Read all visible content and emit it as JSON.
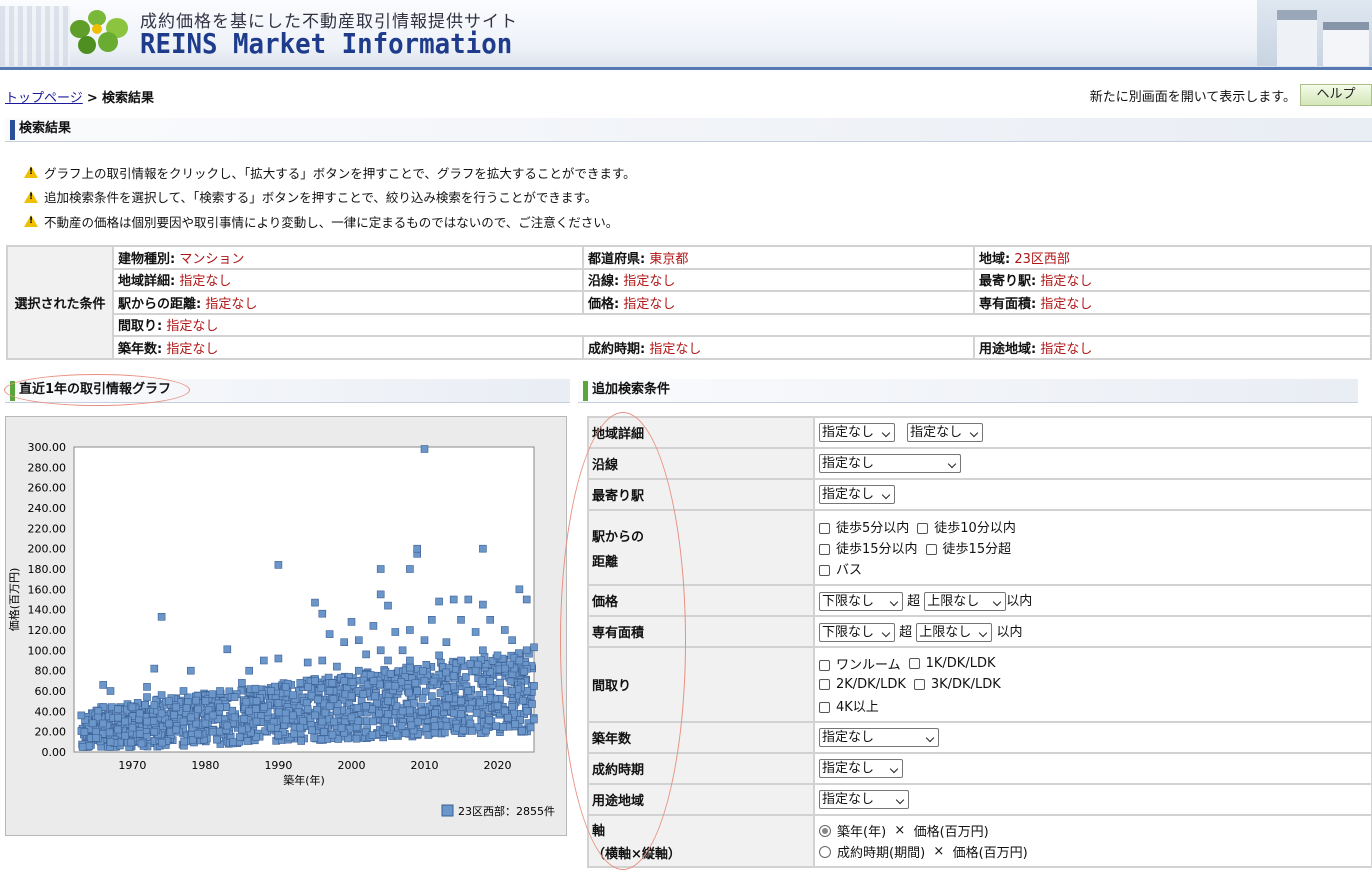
{
  "header": {
    "tagline": "成約価格を基にした不動産取引情報提供サイト",
    "brand": "REINS Market Information"
  },
  "breadcrumb": {
    "top": "トップページ",
    "separator": ">",
    "current": "検索結果"
  },
  "top_right": {
    "note": "新たに別画面を開いて表示します。",
    "help_label": "ヘルプ"
  },
  "section_results": "検索結果",
  "warnings": [
    "グラフ上の取引情報をクリックし、「拡大する」ボタンを押すことで、グラフを拡大することができます。",
    "追加検索条件を選択して、「検索する」ボタンを押すことで、絞り込み検索を行うことができます。",
    "不動産の価格は個別要因や取引事情により変動し、一律に定まるものではないので、ご注意ください。"
  ],
  "conditions": {
    "label": "選択された条件",
    "building_type": {
      "k": "建物種別:",
      "v": "マンション"
    },
    "prefecture": {
      "k": "都道府県:",
      "v": "東京都"
    },
    "area": {
      "k": "地域:",
      "v": "23区西部"
    },
    "area_detail": {
      "k": "地域詳細:",
      "v": "指定なし"
    },
    "line": {
      "k": "沿線:",
      "v": "指定なし"
    },
    "station": {
      "k": "最寄り駅:",
      "v": "指定なし"
    },
    "distance": {
      "k": "駅からの距離:",
      "v": "指定なし"
    },
    "price": {
      "k": "価格:",
      "v": "指定なし"
    },
    "floor_area": {
      "k": "専有面積:",
      "v": "指定なし"
    },
    "layout": {
      "k": "間取り:",
      "v": "指定なし"
    },
    "age": {
      "k": "築年数:",
      "v": "指定なし"
    },
    "contract_period": {
      "k": "成約時期:",
      "v": "指定なし"
    },
    "zoning": {
      "k": "用途地域:",
      "v": "指定なし"
    }
  },
  "section_graph": "直近1年の取引情報グラフ",
  "section_search": "追加検索条件",
  "search": {
    "area_detail": {
      "label": "地域詳細",
      "sel1": "指定なし",
      "sel2": "指定なし"
    },
    "line": {
      "label": "沿線",
      "sel": "指定なし"
    },
    "station": {
      "label": "最寄り駅",
      "sel": "指定なし"
    },
    "distance": {
      "label_1": "駅からの",
      "label_2": "距離",
      "opts": [
        "徒歩5分以内",
        "徒歩10分以内",
        "徒歩15分以内",
        "徒歩15分超",
        "バス"
      ]
    },
    "price": {
      "label": "価格",
      "lower": "下限なし",
      "over": "超",
      "upper": "上限なし",
      "within": "以内"
    },
    "floor_area": {
      "label": "専有面積",
      "lower": "下限なし",
      "over": "超",
      "upper": "上限なし",
      "within": "以内"
    },
    "layout": {
      "label": "間取り",
      "opts": [
        "ワンルーム",
        "1K/DK/LDK",
        "2K/DK/LDK",
        "3K/DK/LDK",
        "4K以上"
      ]
    },
    "age": {
      "label": "築年数",
      "sel": "指定なし"
    },
    "contract_period": {
      "label": "成約時期",
      "sel": "指定なし"
    },
    "zoning": {
      "label": "用途地域",
      "sel": "指定なし"
    },
    "axis": {
      "label_1": "軸",
      "label_2": "（横軸×縦軸）",
      "opt1_a": "築年(年)",
      "opt1_x": "×",
      "opt1_b": "価格(百万円)",
      "opt2_a": "成約時期(期間)",
      "opt2_x": "×",
      "opt2_b": "価格(百万円)"
    }
  },
  "colors": {
    "marker": "#6b96c9",
    "marker_edge": "#3a5f94",
    "accent": "#2b4f99",
    "value_red": "#b01515"
  },
  "chart_data": {
    "type": "scatter",
    "xlabel": "築年(年)",
    "ylabel": "価格(百万円)",
    "xlim": [
      1962,
      2025
    ],
    "ylim": [
      0,
      300
    ],
    "x_ticks": [
      1970,
      1980,
      1990,
      2000,
      2010,
      2020
    ],
    "y_ticks": [
      "0.00",
      "20.00",
      "40.00",
      "60.00",
      "80.00",
      "100.00",
      "120.00",
      "140.00",
      "160.00",
      "180.00",
      "200.00",
      "220.00",
      "240.00",
      "260.00",
      "280.00",
      "300.00"
    ],
    "legend": "23区西部：2855件",
    "legend_position": "bottom-right",
    "series": [
      {
        "name": "23区西部",
        "count": 2855,
        "points": [
          [
            1963,
            36
          ],
          [
            1965,
            20
          ],
          [
            1965,
            14
          ],
          [
            1966,
            28
          ],
          [
            1966,
            66
          ],
          [
            1967,
            60
          ],
          [
            1967,
            10
          ],
          [
            1968,
            42
          ],
          [
            1968,
            22
          ],
          [
            1969,
            30
          ],
          [
            1969,
            16
          ],
          [
            1970,
            44
          ],
          [
            1970,
            24
          ],
          [
            1971,
            38
          ],
          [
            1971,
            18
          ],
          [
            1972,
            64
          ],
          [
            1972,
            54
          ],
          [
            1972,
            30
          ],
          [
            1973,
            82
          ],
          [
            1973,
            46
          ],
          [
            1973,
            20
          ],
          [
            1974,
            133
          ],
          [
            1974,
            38
          ],
          [
            1974,
            56
          ],
          [
            1975,
            28
          ],
          [
            1975,
            50
          ],
          [
            1976,
            22
          ],
          [
            1976,
            44
          ],
          [
            1977,
            30
          ],
          [
            1977,
            60
          ],
          [
            1978,
            80
          ],
          [
            1978,
            34
          ],
          [
            1979,
            18
          ],
          [
            1979,
            42
          ],
          [
            1980,
            28
          ],
          [
            1980,
            50
          ],
          [
            1981,
            20
          ],
          [
            1981,
            36
          ],
          [
            1982,
            60
          ],
          [
            1982,
            44
          ],
          [
            1983,
            101
          ],
          [
            1983,
            26
          ],
          [
            1984,
            54
          ],
          [
            1984,
            34
          ],
          [
            1985,
            68
          ],
          [
            1985,
            22
          ],
          [
            1986,
            40
          ],
          [
            1986,
            80
          ],
          [
            1987,
            50
          ],
          [
            1987,
            30
          ],
          [
            1988,
            90
          ],
          [
            1988,
            44
          ],
          [
            1989,
            60
          ],
          [
            1989,
            24
          ],
          [
            1990,
            184
          ],
          [
            1990,
            48
          ],
          [
            1990,
            92
          ],
          [
            1991,
            64
          ],
          [
            1991,
            32
          ],
          [
            1992,
            56
          ],
          [
            1992,
            36
          ],
          [
            1993,
            68
          ],
          [
            1993,
            24
          ],
          [
            1994,
            88
          ],
          [
            1994,
            42
          ],
          [
            1995,
            147
          ],
          [
            1995,
            70
          ],
          [
            1995,
            36
          ],
          [
            1996,
            136
          ],
          [
            1996,
            90
          ],
          [
            1996,
            30
          ],
          [
            1997,
            116
          ],
          [
            1997,
            60
          ],
          [
            1997,
            45
          ],
          [
            1998,
            84
          ],
          [
            1998,
            40
          ],
          [
            1999,
            108
          ],
          [
            1999,
            70
          ],
          [
            2000,
            128
          ],
          [
            2000,
            55
          ],
          [
            2000,
            34
          ],
          [
            2001,
            110
          ],
          [
            2001,
            80
          ],
          [
            2002,
            96
          ],
          [
            2002,
            45
          ],
          [
            2003,
            124
          ],
          [
            2003,
            70
          ],
          [
            2004,
            180
          ],
          [
            2004,
            155
          ],
          [
            2004,
            100
          ],
          [
            2005,
            144
          ],
          [
            2005,
            90
          ],
          [
            2005,
            50
          ],
          [
            2006,
            118
          ],
          [
            2006,
            65
          ],
          [
            2007,
            100
          ],
          [
            2007,
            40
          ],
          [
            2008,
            180
          ],
          [
            2008,
            120
          ],
          [
            2008,
            90
          ],
          [
            2009,
            195
          ],
          [
            2009,
            200
          ],
          [
            2009,
            60
          ],
          [
            2010,
            298
          ],
          [
            2010,
            110
          ],
          [
            2010,
            70
          ],
          [
            2011,
            130
          ],
          [
            2011,
            55
          ],
          [
            2012,
            148
          ],
          [
            2012,
            95
          ],
          [
            2013,
            108
          ],
          [
            2013,
            45
          ],
          [
            2014,
            150
          ],
          [
            2014,
            75
          ],
          [
            2015,
            130
          ],
          [
            2015,
            90
          ],
          [
            2016,
            150
          ],
          [
            2016,
            60
          ],
          [
            2017,
            118
          ],
          [
            2017,
            80
          ],
          [
            2018,
            200
          ],
          [
            2018,
            145
          ],
          [
            2018,
            100
          ],
          [
            2019,
            130
          ],
          [
            2019,
            70
          ],
          [
            2020,
            95
          ],
          [
            2020,
            45
          ],
          [
            2021,
            120
          ],
          [
            2021,
            82
          ],
          [
            2022,
            110
          ],
          [
            2022,
            60
          ],
          [
            2023,
            160
          ],
          [
            2023,
            90
          ],
          [
            2024,
            150
          ],
          [
            2024,
            100
          ],
          [
            2024,
            40
          ],
          [
            2025,
            103
          ],
          [
            2025,
            65
          ]
        ],
        "cluster_note": "dense cloud of markers between 10 and 100 across 1963-2025"
      }
    ]
  }
}
